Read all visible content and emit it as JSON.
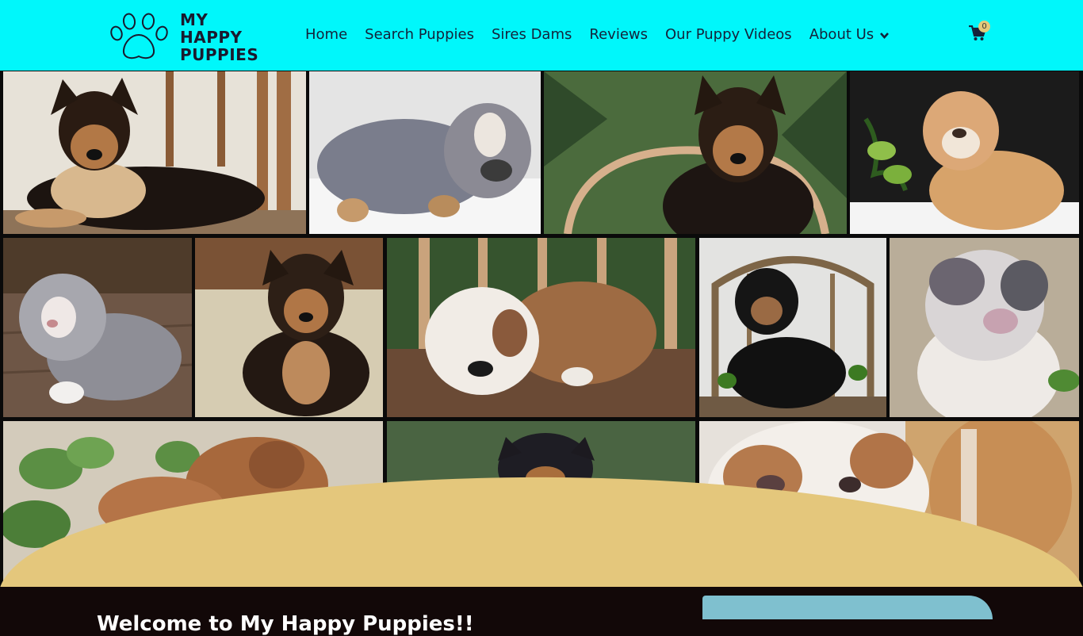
{
  "header": {
    "brand": {
      "line1": "MY",
      "line2": "HAPPY",
      "line3": "PUPPIES",
      "icon": "paw-icon"
    },
    "nav": [
      {
        "label": "Home"
      },
      {
        "label": "Search Puppies"
      },
      {
        "label": "Sires Dams"
      },
      {
        "label": "Reviews"
      },
      {
        "label": "Our Puppy Videos"
      },
      {
        "label": "About Us",
        "icon": "chevron-down-icon"
      }
    ],
    "cart": {
      "icon": "cart-icon",
      "count": "0"
    }
  },
  "colors": {
    "header_bg": "#00f7fb",
    "wave": "#e4c77c",
    "dark_section": "#120808",
    "badge": "#e2c97a"
  },
  "gallery": {
    "photos": [
      "german-shepherd-puppy-on-chair",
      "blue-merle-bulldog-puppy-in-snow",
      "german-shepherd-puppy-by-pine",
      "fawn-bulldog-puppy-in-snow",
      "merle-bulldog-puppy-on-deck",
      "german-shepherd-puppy-on-rock",
      "brindle-bulldog-puppy-on-chair",
      "black-german-shepherd-puppy-on-chair",
      "merle-bulldog-puppy-on-carpet",
      "red-bulldog-puppy-with-ivy",
      "shepherd-puppy-by-pine",
      "white-red-bulldog-puppy"
    ]
  },
  "welcome": {
    "title": "Welcome to My Happy Puppies!!"
  }
}
